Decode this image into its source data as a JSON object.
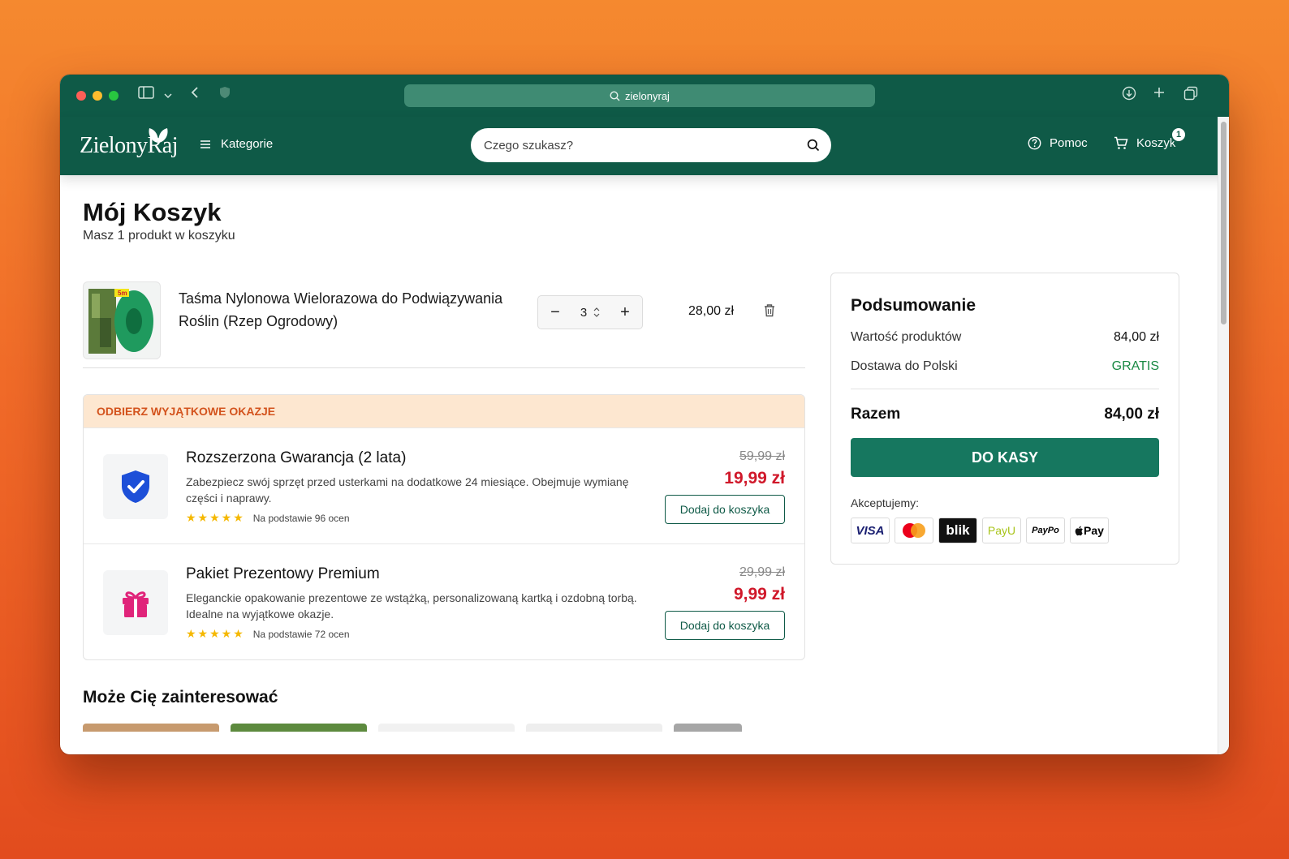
{
  "browser": {
    "url": "zielonyraj"
  },
  "header": {
    "logo_text": "ZielonyRaj",
    "categories_label": "Kategorie",
    "search_placeholder": "Czego szukasz?",
    "help_label": "Pomoc",
    "cart_label": "Koszyk",
    "cart_count": "1"
  },
  "page": {
    "title": "Mój Koszyk",
    "subtitle": "Masz 1 produkt w koszyku"
  },
  "cart_item": {
    "name": "Taśma Nylonowa Wielorazowa do Podwiązywania Roślin (Rzep Ogrodowy)",
    "quantity": "3",
    "price": "28,00 zł",
    "image_label": "5m"
  },
  "offers": {
    "heading": "ODBIERZ WYJĄTKOWE OKAZJE",
    "items": [
      {
        "title": "Rozszerzona Gwarancja (2 lata)",
        "description": "Zabezpiecz swój sprzęt przed usterkami na dodatkowe 24 miesiące. Obejmuje wymianę części i naprawy.",
        "rating_text": "Na podstawie 96 ocen",
        "stars": "★★★★★",
        "old_price": "59,99 zł",
        "new_price": "19,99 zł",
        "button": "Dodaj do koszyka",
        "icon": "shield-check-icon"
      },
      {
        "title": "Pakiet Prezentowy Premium",
        "description": "Eleganckie opakowanie prezentowe ze wstążką, personalizowaną kartką i ozdobną torbą. Idealne na wyjątkowe okazje.",
        "rating_text": "Na podstawie 72 ocen",
        "stars": "★★★★★",
        "old_price": "29,99 zł",
        "new_price": "9,99 zł",
        "button": "Dodaj do koszyka",
        "icon": "gift-icon"
      }
    ]
  },
  "more": {
    "title": "Może Cię zainteresować"
  },
  "summary": {
    "title": "Podsumowanie",
    "products_label": "Wartość produktów",
    "products_value": "84,00 zł",
    "delivery_label": "Dostawa do Polski",
    "delivery_value": "GRATIS",
    "total_label": "Razem",
    "total_value": "84,00 zł",
    "checkout_button": "DO KASY",
    "accept_label": "Akceptujemy:",
    "payments": [
      "VISA",
      "Mastercard",
      "blik",
      "PayU",
      "PayPo",
      "Pay"
    ]
  },
  "colors": {
    "brand_green": "#0f5a47",
    "checkout_green": "#16775f",
    "sale_red": "#d0182a",
    "offer_orange": "#d3531d"
  }
}
